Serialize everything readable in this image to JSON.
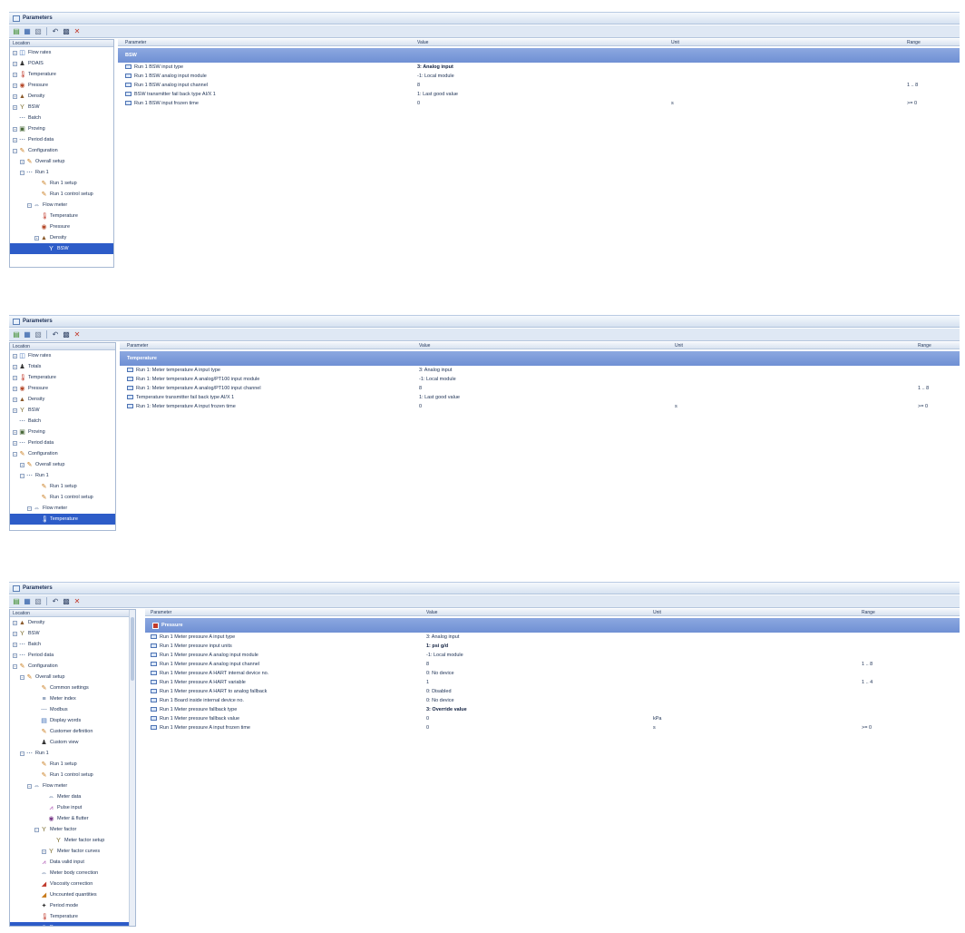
{
  "panels": [
    {
      "title": "Parameters",
      "tree_header": "Location",
      "tree": [
        {
          "label": "Flow rates",
          "icon": "flow-rates-icon",
          "glyph": "◫",
          "color": "#3a6bb5",
          "exp": "+",
          "ind": 0
        },
        {
          "label": "POAIS",
          "icon": "poais-icon",
          "glyph": "♟",
          "color": "#333333",
          "exp": "+",
          "ind": 0
        },
        {
          "label": "Temperature",
          "icon": "temperature-icon",
          "glyph": "🌡",
          "color": "#c0392b",
          "exp": "+",
          "ind": 0
        },
        {
          "label": "Pressure",
          "icon": "pressure-icon",
          "glyph": "◉",
          "color": "#b5492a",
          "exp": "+",
          "ind": 0
        },
        {
          "label": "Density",
          "icon": "density-icon",
          "glyph": "▲",
          "color": "#8a5a2b",
          "exp": "+",
          "ind": 0
        },
        {
          "label": "BSW",
          "icon": "bsw-icon",
          "glyph": "Y",
          "color": "#7a6a2a",
          "exp": "+",
          "ind": 0
        },
        {
          "label": "Batch",
          "icon": "batch-icon",
          "glyph": "⋯",
          "color": "#3a5a8a",
          "exp": "",
          "ind": 0
        },
        {
          "label": "Proving",
          "icon": "proving-icon",
          "glyph": "▣",
          "color": "#4a6a3a",
          "exp": "+",
          "ind": 0
        },
        {
          "label": "Period data",
          "icon": "period-data-icon",
          "glyph": "⋯",
          "color": "#3a5a8a",
          "exp": "+",
          "ind": 0
        },
        {
          "label": "Configuration",
          "icon": "configuration-icon",
          "glyph": "✎",
          "color": "#c87a1a",
          "exp": "−",
          "ind": 0
        },
        {
          "label": "Overall setup",
          "icon": "overall-setup-icon",
          "glyph": "✎",
          "color": "#c87a1a",
          "exp": "+",
          "ind": 1
        },
        {
          "label": "Run 1",
          "icon": "run-icon",
          "glyph": "⋯",
          "color": "#3a5a8a",
          "exp": "−",
          "ind": 1
        },
        {
          "label": "Run 1 setup",
          "icon": "run-setup-icon",
          "glyph": "✎",
          "color": "#c87a1a",
          "exp": "",
          "ind": 3
        },
        {
          "label": "Run 1 control setup",
          "icon": "run-control-setup-icon",
          "glyph": "✎",
          "color": "#c87a1a",
          "exp": "",
          "ind": 3
        },
        {
          "label": "Flow meter",
          "icon": "flow-meter-icon",
          "glyph": "⇔",
          "color": "#3a5a8a",
          "exp": "−",
          "ind": 2
        },
        {
          "label": "Temperature",
          "icon": "temperature-icon",
          "glyph": "🌡",
          "color": "#c0392b",
          "exp": "",
          "ind": 3
        },
        {
          "label": "Pressure",
          "icon": "pressure-icon",
          "glyph": "◉",
          "color": "#b5492a",
          "exp": "",
          "ind": 3
        },
        {
          "label": "Density",
          "icon": "density-icon",
          "glyph": "▲",
          "color": "#8a5a2b",
          "exp": "+",
          "ind": 3
        },
        {
          "label": "BSW",
          "icon": "bsw-icon",
          "glyph": "Y",
          "color": "#ffffff",
          "exp": "",
          "ind": 4,
          "sel": true
        }
      ],
      "columns": [
        "Parameter",
        "Value",
        "Unit",
        "Range"
      ],
      "group": "BSW",
      "rows": [
        {
          "p": "Run 1 BSW input type",
          "v": "3: Analog input",
          "u": "",
          "r": "",
          "bold": true
        },
        {
          "p": "Run 1 BSW analog input module",
          "v": "-1: Local module",
          "u": "",
          "r": ""
        },
        {
          "p": "Run 1 BSW analog input channel",
          "v": "8",
          "u": "",
          "r": "1 .. 8"
        },
        {
          "p": "BSW transmitter fail back type AI/X 1",
          "v": "1: Last good value",
          "u": "",
          "r": ""
        },
        {
          "p": "Run 1 BSW input frozen time",
          "v": "0",
          "u": "s",
          "r": ">= 0"
        }
      ]
    },
    {
      "title": "Parameters",
      "tree_header": "Location",
      "tree": [
        {
          "label": "Flow rates",
          "icon": "flow-rates-icon",
          "glyph": "◫",
          "color": "#3a6bb5",
          "exp": "+",
          "ind": 0
        },
        {
          "label": "Totals",
          "icon": "totals-icon",
          "glyph": "♟",
          "color": "#333333",
          "exp": "+",
          "ind": 0
        },
        {
          "label": "Temperature",
          "icon": "temperature-icon",
          "glyph": "🌡",
          "color": "#c0392b",
          "exp": "+",
          "ind": 0
        },
        {
          "label": "Pressure",
          "icon": "pressure-icon",
          "glyph": "◉",
          "color": "#b5492a",
          "exp": "+",
          "ind": 0
        },
        {
          "label": "Density",
          "icon": "density-icon",
          "glyph": "▲",
          "color": "#8a5a2b",
          "exp": "+",
          "ind": 0
        },
        {
          "label": "BSW",
          "icon": "bsw-icon",
          "glyph": "Y",
          "color": "#7a6a2a",
          "exp": "+",
          "ind": 0
        },
        {
          "label": "Batch",
          "icon": "batch-icon",
          "glyph": "⋯",
          "color": "#3a5a8a",
          "exp": "",
          "ind": 0
        },
        {
          "label": "Proving",
          "icon": "proving-icon",
          "glyph": "▣",
          "color": "#4a6a3a",
          "exp": "+",
          "ind": 0
        },
        {
          "label": "Period data",
          "icon": "period-data-icon",
          "glyph": "⋯",
          "color": "#3a5a8a",
          "exp": "+",
          "ind": 0
        },
        {
          "label": "Configuration",
          "icon": "configuration-icon",
          "glyph": "✎",
          "color": "#c87a1a",
          "exp": "−",
          "ind": 0
        },
        {
          "label": "Overall setup",
          "icon": "overall-setup-icon",
          "glyph": "✎",
          "color": "#c87a1a",
          "exp": "+",
          "ind": 1
        },
        {
          "label": "Run 1",
          "icon": "run-icon",
          "glyph": "⋯",
          "color": "#3a5a8a",
          "exp": "−",
          "ind": 1
        },
        {
          "label": "Run 1 setup",
          "icon": "run-setup-icon",
          "glyph": "✎",
          "color": "#c87a1a",
          "exp": "",
          "ind": 3
        },
        {
          "label": "Run 1 control setup",
          "icon": "run-control-setup-icon",
          "glyph": "✎",
          "color": "#c87a1a",
          "exp": "",
          "ind": 3
        },
        {
          "label": "Flow meter",
          "icon": "flow-meter-icon",
          "glyph": "⇔",
          "color": "#3a5a8a",
          "exp": "−",
          "ind": 2
        },
        {
          "label": "Temperature",
          "icon": "temperature-icon",
          "glyph": "🌡",
          "color": "#ffffff",
          "exp": "",
          "ind": 3,
          "sel": true
        }
      ],
      "columns": [
        "Parameter",
        "Value",
        "Unit",
        "Range"
      ],
      "group": "Temperature",
      "rows": [
        {
          "p": "Run 1: Meter temperature A input type",
          "v": "3: Analog input",
          "u": "",
          "r": ""
        },
        {
          "p": "Run 1: Meter temperature A analog/PT100 input module",
          "v": "-1: Local module",
          "u": "",
          "r": ""
        },
        {
          "p": "Run 1: Meter temperature A analog/PT100 input channel",
          "v": "8",
          "u": "",
          "r": "1 .. 8"
        },
        {
          "p": "Temperature transmitter fail back type AI/X 1",
          "v": "1: Last good value",
          "u": "",
          "r": ""
        },
        {
          "p": "Run 1: Meter temperature A input frozen time",
          "v": "0",
          "u": "s",
          "r": ">= 0"
        }
      ]
    },
    {
      "title": "Parameters",
      "tree_header": "Location",
      "tree": [
        {
          "label": "Density",
          "icon": "density-icon",
          "glyph": "▲",
          "color": "#8a5a2b",
          "exp": "+",
          "ind": 0
        },
        {
          "label": "BSW",
          "icon": "bsw-icon",
          "glyph": "Y",
          "color": "#7a6a2a",
          "exp": "+",
          "ind": 0
        },
        {
          "label": "Batch",
          "icon": "batch-icon",
          "glyph": "⋯",
          "color": "#3a5a8a",
          "exp": "+",
          "ind": 0
        },
        {
          "label": "Period data",
          "icon": "period-data-icon",
          "glyph": "⋯",
          "color": "#3a5a8a",
          "exp": "+",
          "ind": 0
        },
        {
          "label": "Configuration",
          "icon": "configuration-icon",
          "glyph": "✎",
          "color": "#c87a1a",
          "exp": "−",
          "ind": 0
        },
        {
          "label": "Overall setup",
          "icon": "overall-setup-icon",
          "glyph": "✎",
          "color": "#c87a1a",
          "exp": "−",
          "ind": 1
        },
        {
          "label": "Common settings",
          "icon": "common-settings-icon",
          "glyph": "✎",
          "color": "#c87a1a",
          "exp": "",
          "ind": 3
        },
        {
          "label": "Meter index",
          "icon": "meter-index-icon",
          "glyph": "≡",
          "color": "#3a5a8a",
          "exp": "",
          "ind": 3
        },
        {
          "label": "Modbus",
          "icon": "modbus-icon",
          "glyph": "⋯",
          "color": "#3a5a8a",
          "exp": "",
          "ind": 3
        },
        {
          "label": "Display words",
          "icon": "display-words-icon",
          "glyph": "▤",
          "color": "#3a6bb5",
          "exp": "",
          "ind": 3
        },
        {
          "label": "Customer definition",
          "icon": "customer-definition-icon",
          "glyph": "✎",
          "color": "#c87a1a",
          "exp": "",
          "ind": 3
        },
        {
          "label": "Custom view",
          "icon": "custom-view-icon",
          "glyph": "♟",
          "color": "#333333",
          "exp": "",
          "ind": 3
        },
        {
          "label": "Run 1",
          "icon": "run-icon",
          "glyph": "⋯",
          "color": "#3a5a8a",
          "exp": "−",
          "ind": 1
        },
        {
          "label": "Run 1 setup",
          "icon": "run-setup-icon",
          "glyph": "✎",
          "color": "#c87a1a",
          "exp": "",
          "ind": 3
        },
        {
          "label": "Run 1 control setup",
          "icon": "run-control-setup-icon",
          "glyph": "✎",
          "color": "#c87a1a",
          "exp": "",
          "ind": 3
        },
        {
          "label": "Flow meter",
          "icon": "flow-meter-icon",
          "glyph": "⇔",
          "color": "#3a5a8a",
          "exp": "−",
          "ind": 2
        },
        {
          "label": "Meter data",
          "icon": "meter-data-icon",
          "glyph": "⇔",
          "color": "#3a5a8a",
          "exp": "",
          "ind": 4
        },
        {
          "label": "Pulse input",
          "icon": "pulse-input-icon",
          "glyph": "⩘",
          "color": "#a23ea8",
          "exp": "",
          "ind": 4
        },
        {
          "label": "Meter & flutter",
          "icon": "meter-flutter-icon",
          "glyph": "◉",
          "color": "#7a3b8a",
          "exp": "",
          "ind": 4
        },
        {
          "label": "Meter factor",
          "icon": "meter-factor-icon",
          "glyph": "Y",
          "color": "#7a6a2a",
          "exp": "−",
          "ind": 3
        },
        {
          "label": "Meter factor setup",
          "icon": "meter-factor-setup-icon",
          "glyph": "Y",
          "color": "#7a6a2a",
          "exp": "",
          "ind": 5
        },
        {
          "label": "Meter factor curves",
          "icon": "meter-factor-curves-icon",
          "glyph": "Y",
          "color": "#7a6a2a",
          "exp": "+",
          "ind": 4
        },
        {
          "label": "Data valid input",
          "icon": "data-valid-input-icon",
          "glyph": "⩘",
          "color": "#a23ea8",
          "exp": "",
          "ind": 3
        },
        {
          "label": "Meter body correction",
          "icon": "meter-body-correction-icon",
          "glyph": "⇔",
          "color": "#3a5a8a",
          "exp": "",
          "ind": 3
        },
        {
          "label": "Viscosity correction",
          "icon": "viscosity-correction-icon",
          "glyph": "◢",
          "color": "#c0392b",
          "exp": "",
          "ind": 3
        },
        {
          "label": "Uncounted quantities",
          "icon": "uncounted-quantities-icon",
          "glyph": "◢",
          "color": "#c87a1a",
          "exp": "",
          "ind": 3
        },
        {
          "label": "Period mode",
          "icon": "period-mode-icon",
          "glyph": "✦",
          "color": "#333333",
          "exp": "",
          "ind": 3
        },
        {
          "label": "Temperature",
          "icon": "temperature-icon",
          "glyph": "🌡",
          "color": "#c0392b",
          "exp": "",
          "ind": 3
        },
        {
          "label": "Pressure",
          "icon": "pressure-icon",
          "glyph": "◉",
          "color": "#ffffff",
          "exp": "",
          "ind": 3,
          "sel": true
        }
      ],
      "columns": [
        "Parameter",
        "Value",
        "Unit",
        "Range"
      ],
      "group": "Pressure",
      "rows": [
        {
          "p": "Run 1 Meter pressure A input type",
          "v": "3: Analog input",
          "u": "",
          "r": ""
        },
        {
          "p": "Run 1 Meter pressure input units",
          "v": "1: psi g/d",
          "u": "",
          "r": "",
          "bold": true
        },
        {
          "p": "Run 1 Meter pressure A analog input module",
          "v": "-1: Local module",
          "u": "",
          "r": ""
        },
        {
          "p": "Run 1 Meter pressure A analog input channel",
          "v": "8",
          "u": "",
          "r": "1 .. 8"
        },
        {
          "p": "Run 1 Meter pressure A HART internal device no.",
          "v": "0: No device",
          "u": "",
          "r": ""
        },
        {
          "p": "Run 1 Meter pressure A HART variable",
          "v": "1",
          "u": "",
          "r": "1 .. 4"
        },
        {
          "p": "Run 1 Meter pressure A HART to analog fallback",
          "v": "0: Disabled",
          "u": "",
          "r": ""
        },
        {
          "p": "Run 1 Board inside internal device no.",
          "v": "0: No device",
          "u": "",
          "r": ""
        },
        {
          "p": "Run 1 Meter pressure fallback type",
          "v": "3: Override value",
          "u": "",
          "r": "",
          "bold": true
        },
        {
          "p": "Run 1 Meter pressure fallback value",
          "v": "0",
          "u": "kPa",
          "r": ""
        },
        {
          "p": "Run 1 Meter pressure A input frozen time",
          "v": "0",
          "u": "s",
          "r": ">= 0"
        }
      ]
    }
  ],
  "toolbar": [
    {
      "name": "open-icon",
      "glyph": "▤",
      "cls": "green"
    },
    {
      "name": "save-icon",
      "glyph": "▦",
      "cls": "blue"
    },
    {
      "name": "print-icon",
      "glyph": "▧",
      "cls": "gray"
    },
    {
      "name": "undo-icon",
      "glyph": "↶",
      "cls": "dark"
    },
    {
      "name": "export-icon",
      "glyph": "▩",
      "cls": "dark"
    },
    {
      "name": "delete-icon",
      "glyph": "✕",
      "cls": "red"
    }
  ]
}
